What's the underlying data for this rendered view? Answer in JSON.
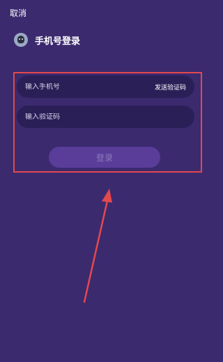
{
  "nav": {
    "cancel_label": "取消"
  },
  "header": {
    "title": "手机号登录"
  },
  "form": {
    "phone_placeholder": "输入手机号",
    "send_code_label": "发送验证码",
    "code_placeholder": "输入验证码",
    "login_label": "登录"
  },
  "colors": {
    "background": "#3b2a6e",
    "field": "#2a1f57",
    "button": "#5a3c99",
    "annotation": "#e5484d"
  }
}
